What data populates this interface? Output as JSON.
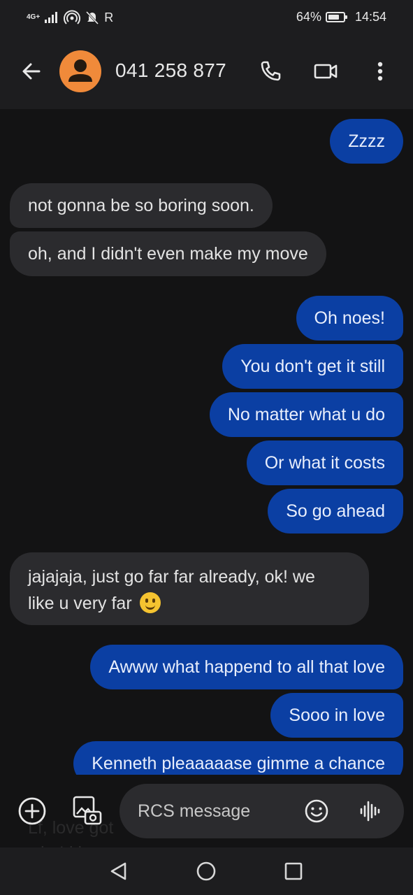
{
  "status_bar": {
    "network": "4G+",
    "roaming": "R",
    "battery_percent": "64%",
    "battery_level": 0.64,
    "time": "14:54"
  },
  "header": {
    "contact": "041 258 877",
    "icons": [
      "back-arrow-icon",
      "person-avatar-icon",
      "phone-icon",
      "video-camera-icon",
      "more-vert-icon"
    ]
  },
  "messages": [
    {
      "dir": "out",
      "text": "Zzzz"
    },
    {
      "dir": "in",
      "text": "not gonna be so boring soon."
    },
    {
      "dir": "in",
      "text": "oh, and I didn't even make my move"
    },
    {
      "dir": "out",
      "text": "Oh noes!"
    },
    {
      "dir": "out",
      "text": "You don't get it still"
    },
    {
      "dir": "out",
      "text": "No matter what u do"
    },
    {
      "dir": "out",
      "text": "Or what it costs"
    },
    {
      "dir": "out",
      "text": "So go ahead"
    },
    {
      "dir": "in",
      "line1": "jajajaja, just go far far already, ok! we",
      "line2": "like u very far",
      "emoji": "slightly-smiling-face-emoji"
    },
    {
      "dir": "out",
      "text": "Awww what happend to all that love"
    },
    {
      "dir": "out",
      "text": "Sooo in love"
    },
    {
      "dir": "out",
      "text": "Kenneth pleaaaaase gimme a chance"
    }
  ],
  "ghost_text": {
    "line1": "Lf, love got",
    "line2": "who'd knew"
  },
  "composer": {
    "placeholder": "RCS message",
    "icons": [
      "add-circle-icon",
      "gallery-camera-icon",
      "emoji-icon",
      "voice-waveform-icon"
    ]
  },
  "navigation": {
    "icons": [
      "nav-back-icon",
      "nav-home-icon",
      "nav-recents-icon"
    ]
  },
  "colors": {
    "outgoing_bubble": "#0b3fa3",
    "incoming_bubble": "#2b2b2e",
    "avatar": "#f08a3a",
    "background": "#131314"
  }
}
